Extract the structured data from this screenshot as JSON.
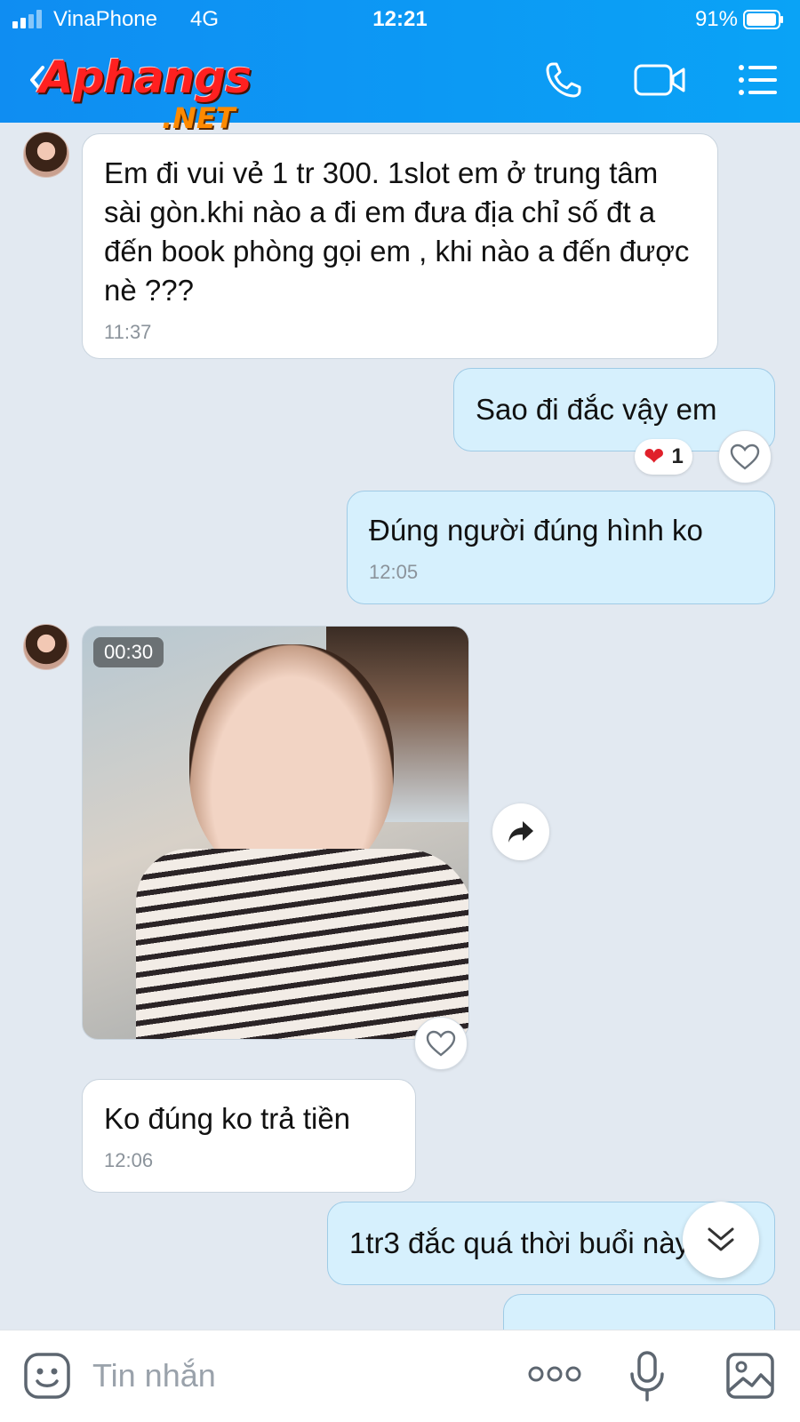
{
  "status_bar": {
    "carrier": "VinaPhone",
    "network": "4G",
    "time": "12:21",
    "battery": "91%"
  },
  "header": {
    "logo_word": "Aphangs",
    "logo_suffix": ".NET",
    "icons": [
      "back-icon",
      "call-icon",
      "video-call-icon",
      "menu-icon"
    ]
  },
  "messages": [
    {
      "direction": "in",
      "text": "Em đi vui vẻ 1 tr 300. 1slot em ở trung tâm sài gòn.khi nào a đi em đưa địa chỉ số đt a đến book phòng gọi em , khi nào a đến được nè ???",
      "time": "11:37"
    },
    {
      "direction": "out",
      "text": "Sao đi đắc vậy em",
      "reaction": {
        "emoji": "❤",
        "count": "1"
      }
    },
    {
      "direction": "out",
      "text": "Đúng người đúng hình ko",
      "time": "12:05"
    },
    {
      "direction": "in",
      "type": "video",
      "duration": "00:30"
    },
    {
      "direction": "in",
      "text": "Ko đúng ko trả tiền",
      "time": "12:06"
    },
    {
      "direction": "out",
      "text": "1tr3 đắc quá thời buổi này"
    }
  ],
  "composer": {
    "placeholder": "Tin nhắn",
    "more_label": "ooo"
  },
  "colors": {
    "header": "#0f8df2",
    "out_bubble": "#d6f0fd",
    "in_bubble": "#ffffff",
    "background": "#e2e9f1"
  }
}
